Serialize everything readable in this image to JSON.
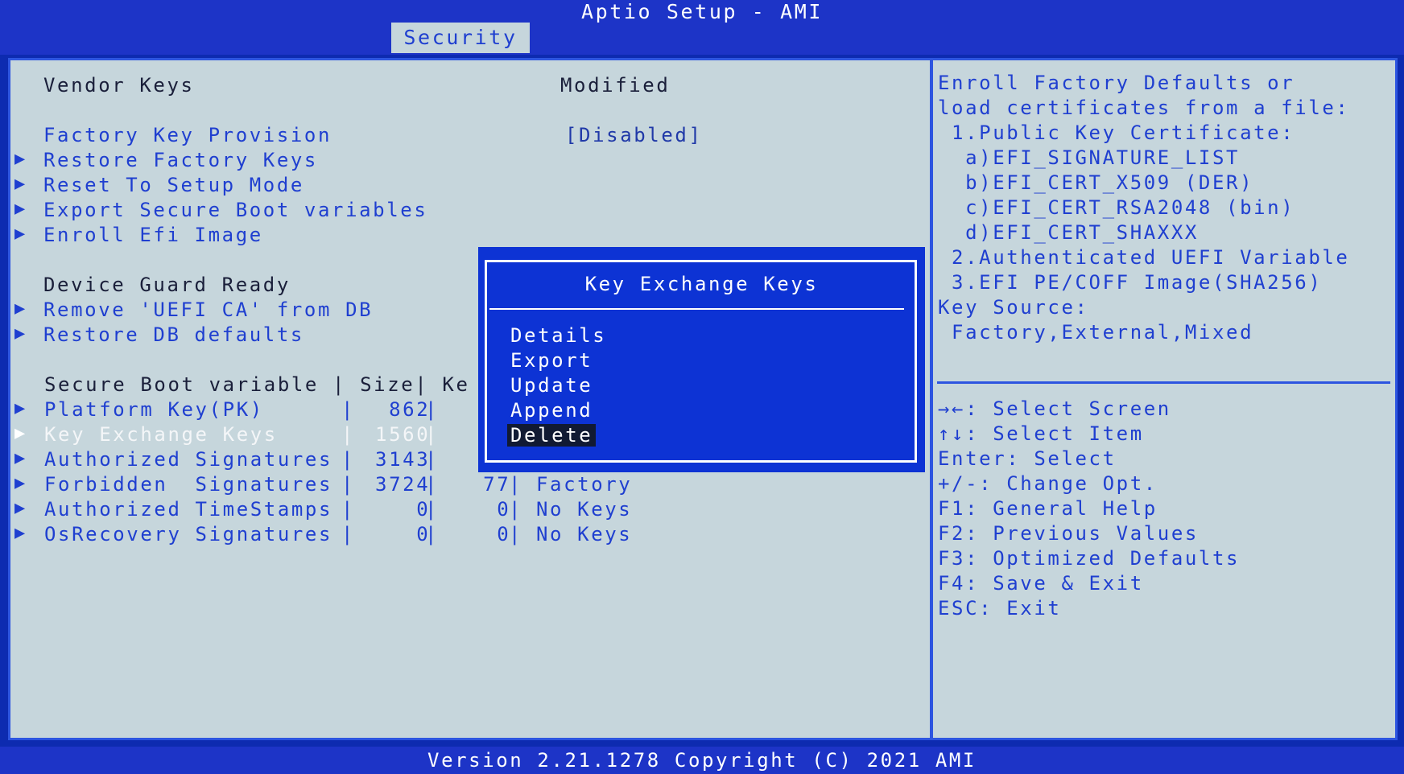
{
  "window": {
    "title": "Aptio Setup - AMI",
    "tab": "Security",
    "footer": "Version 2.21.1278 Copyright (C) 2021 AMI"
  },
  "main": {
    "vendor_keys_label": "Vendor Keys",
    "vendor_keys_value": "Modified",
    "factory_key_label": "Factory Key Provision",
    "factory_key_value": "[Disabled]",
    "actions": [
      "Restore Factory Keys",
      "Reset To Setup Mode",
      "Export Secure Boot variables",
      "Enroll Efi Image"
    ],
    "device_guard_label": "Device Guard Ready",
    "device_guard_actions": [
      "Remove 'UEFI CA' from DB",
      "Restore DB defaults"
    ],
    "table_header": "Secure Boot variable | Size| Ke",
    "table_rows": [
      {
        "name": "Platform Key(PK)     ",
        "size": "  862",
        "keys": "",
        "source": ""
      },
      {
        "name": "Key Exchange Keys    ",
        "size": " 1560",
        "keys": "",
        "source": ""
      },
      {
        "name": "Authorized Signatures",
        "size": " 3143",
        "keys": "",
        "source": ""
      },
      {
        "name": "Forbidden  Signatures",
        "size": " 3724",
        "keys": "   77",
        "source": "Factory"
      },
      {
        "name": "Authorized TimeStamps",
        "size": "    0",
        "keys": "    0",
        "source": "No Keys"
      },
      {
        "name": "OsRecovery Signatures",
        "size": "    0",
        "keys": "    0",
        "source": "No Keys"
      }
    ],
    "table_sep": "|"
  },
  "help": {
    "lines": [
      "Enroll Factory Defaults or",
      "load certificates from a file:",
      " 1.Public Key Certificate:",
      "  a)EFI_SIGNATURE_LIST",
      "  b)EFI_CERT_X509 (DER)",
      "  c)EFI_CERT_RSA2048 (bin)",
      "  d)EFI_CERT_SHAXXX",
      " 2.Authenticated UEFI Variable",
      " 3.EFI PE/COFF Image(SHA256)",
      "Key Source:",
      " Factory,External,Mixed"
    ],
    "keys": [
      "→←: Select Screen",
      "↑↓: Select Item",
      "Enter: Select",
      "+/-: Change Opt.",
      "F1: General Help",
      "F2: Previous Values",
      "F3: Optimized Defaults",
      "F4: Save & Exit",
      "ESC: Exit"
    ]
  },
  "popup": {
    "title": "Key Exchange Keys",
    "options": [
      "Details",
      "Export",
      "Update",
      "Append",
      "Delete"
    ],
    "selected_option": "Delete"
  },
  "colors": {
    "background": "#c6d6dc",
    "bar": "#1d34c7",
    "accent": "#1f3fd0",
    "popup": "#0d33d4"
  }
}
